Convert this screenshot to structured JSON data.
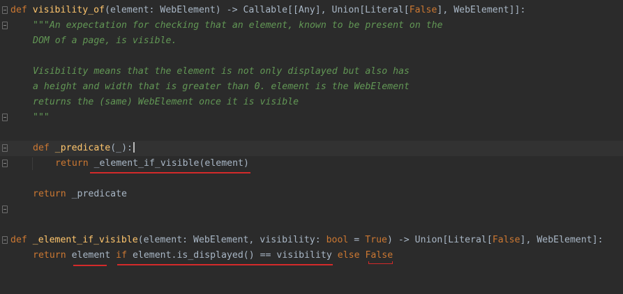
{
  "editor": {
    "lines": {
      "l1": {
        "kw_def": "def",
        "fn_name": "visibility_of",
        "p1": "(element: WebElement) -> Callable[[Any], Union[Literal[",
        "kw_false": "False",
        "p2": "], WebElement]]:"
      },
      "l2": "\"\"\"An expectation for checking that an element, known to be present on the",
      "l3": "DOM of a page, is visible.",
      "l4": "",
      "l5": "Visibility means that the element is not only displayed but also has",
      "l6": "a height and width that is greater than 0. element is the WebElement",
      "l7": "returns the (same) WebElement once it is visible",
      "l8": "\"\"\"",
      "l9": "",
      "l10": {
        "kw_def": "def",
        "fn_name": "_predicate",
        "rest": "(_):"
      },
      "l11": {
        "kw_return": "return",
        "call": "_element_if_visible(element)"
      },
      "l12": "",
      "l13": {
        "kw_return": "return",
        "rest": "_predicate"
      },
      "l14": "",
      "l15": "",
      "l16": {
        "kw_def": "def",
        "fn_name": "_element_if_visible",
        "p1": "(element: WebElement, visibility: ",
        "kw_bool": "bool",
        "p2": " = ",
        "kw_true": "True",
        "p3": ") -> Union[Literal[",
        "kw_false": "False",
        "p4": "], WebElement]:"
      },
      "l17": {
        "kw_return": "return",
        "t_element": "element",
        "kw_if": "if",
        "t_expr": "element.is_displayed() == visibility",
        "kw_else": "else",
        "kw_false": "False"
      }
    },
    "colors": {
      "background": "#2b2b2b",
      "keyword": "#cc7832",
      "function": "#ffc66d",
      "docstring": "#629755",
      "text": "#a9b7c6",
      "annotation_underline": "#d42a2a"
    }
  }
}
